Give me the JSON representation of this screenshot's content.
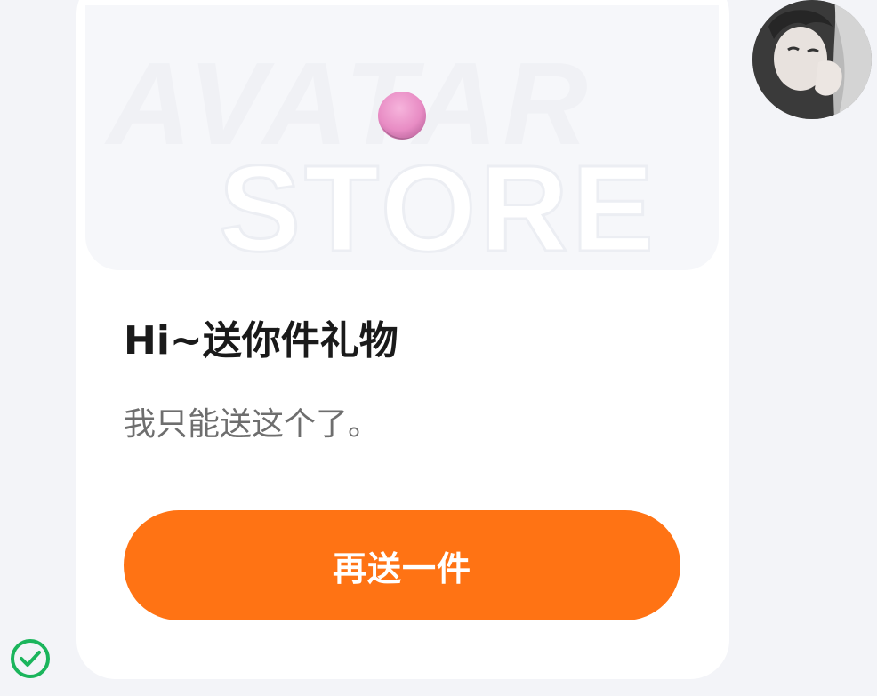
{
  "banner": {
    "wordmark_line1": "AVATAR",
    "wordmark_line2": "STORE"
  },
  "card": {
    "title": "Hi~送你件礼物",
    "subtitle": "我只能送这个了。",
    "button_label": "再送一件"
  },
  "icons": {
    "check": "check-circle-icon",
    "gift_item": "pink-ball-icon",
    "avatar": "user-avatar"
  },
  "colors": {
    "accent": "#ff7314",
    "check": "#1bb55c",
    "gift": "#ec98c8"
  }
}
